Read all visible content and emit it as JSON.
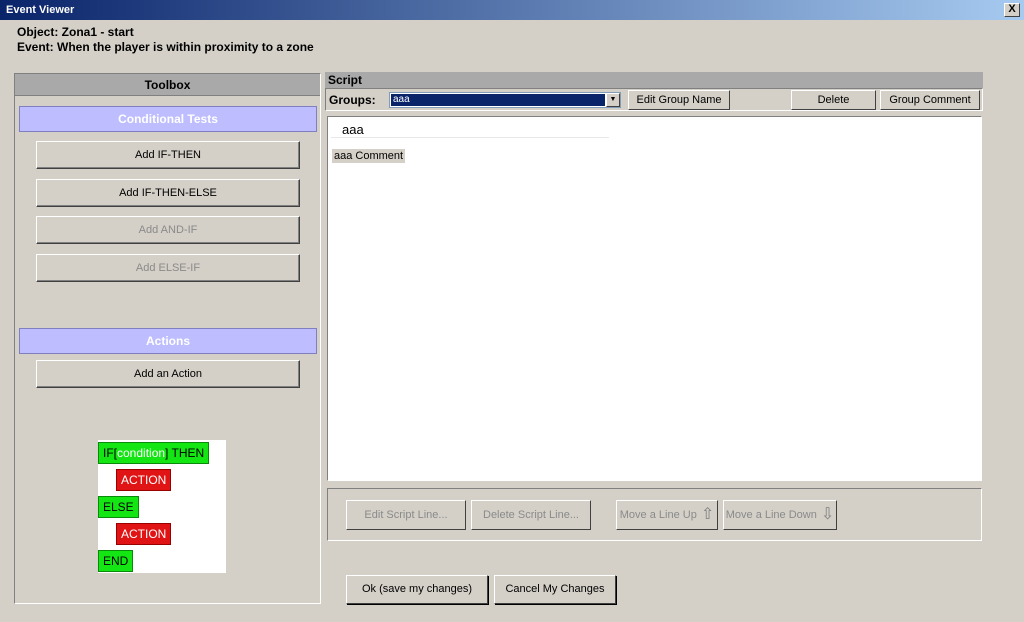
{
  "window": {
    "title": "Event Viewer",
    "close_label": "X"
  },
  "info": {
    "object": "Object: Zona1 - start",
    "event": "Event: When the player is within proximity to a zone"
  },
  "toolbox": {
    "title": "Toolbox",
    "conditional_title": "Conditional Tests",
    "add_if_then": "Add IF-THEN",
    "add_if_then_else": "Add IF-THEN-ELSE",
    "add_and_if": "Add AND-IF",
    "add_else_if": "Add ELSE-IF",
    "actions_title": "Actions",
    "add_action": "Add an Action"
  },
  "legend": {
    "if_prefix": "IF[",
    "condition": "condition",
    "then_suffix": "] THEN",
    "action1": "ACTION",
    "else": "ELSE",
    "action2": "ACTION",
    "end": "END"
  },
  "script": {
    "title": "Script",
    "groups_label": "Groups:",
    "selected_group": "aaa",
    "edit_group_name": "Edit Group Name",
    "delete": "Delete",
    "group_comment": "Group Comment",
    "group_name": "aaa",
    "comment_text": "aaa Comment"
  },
  "actions": {
    "edit_line": "Edit Script Line...",
    "delete_line": "Delete Script Line...",
    "move_up": "Move a Line Up",
    "move_down": "Move a Line Down"
  },
  "footer": {
    "ok": "Ok (save my changes)",
    "cancel": "Cancel My Changes"
  },
  "colors": {
    "section_bar": "#bdbdff",
    "legend_green": "#14e614",
    "legend_red": "#e01414",
    "selection": "#0a246a"
  }
}
